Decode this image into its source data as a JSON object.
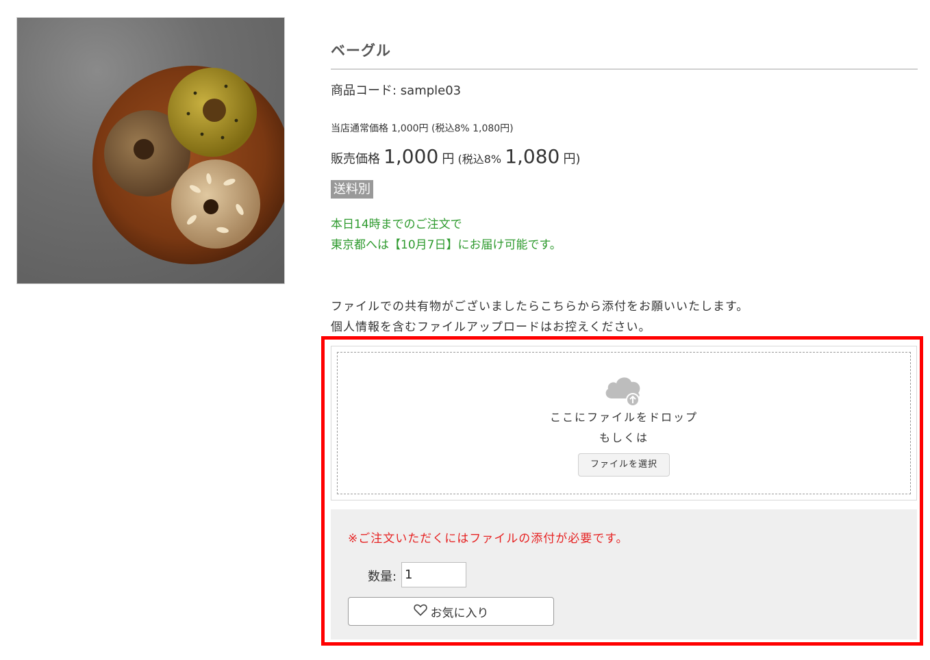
{
  "product": {
    "image_alt": "bagel-photo",
    "title": "ベーグル",
    "code_label": "商品コード: sample03",
    "regular_price": "当店通常価格 1,000円 (税込8% 1,080円)",
    "sale_label": "販売価格",
    "sale_price": "1,000",
    "sale_unit": "円",
    "tax_label": "(税込8%",
    "tax_price": "1,080",
    "tax_unit": "円)",
    "shipping_badge": "送料別"
  },
  "delivery": {
    "line1": "本日14時までのご注文で",
    "line2": "東京都へは【10月7日】にお届け可能です。"
  },
  "upload": {
    "notice_line1": "ファイルでの共有物がございましたらこちらから添付をお願いいたします。",
    "notice_line2": "個人情報を含むファイルアップロードはお控えください。",
    "drop_text": "ここにファイルをドロップ",
    "or_text": "もしくは",
    "select_button": "ファイルを選択",
    "icon": "cloud-upload-icon"
  },
  "cart": {
    "required_message": "※ご注文いただくにはファイルの添付が必要です。",
    "quantity_label": "数量:",
    "quantity_value": "1",
    "favorite_button": "お気に入り",
    "favorite_icon": "heart-icon"
  },
  "colors": {
    "highlight": "#ff0000",
    "delivery_text": "#2e9a2e",
    "required_text": "#e62222",
    "badge_bg": "#999999"
  }
}
